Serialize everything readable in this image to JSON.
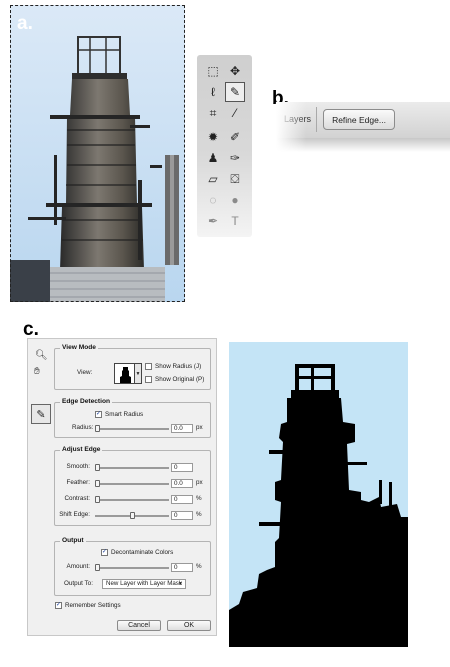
{
  "panel_labels": {
    "a": "a.",
    "b": "b.",
    "c": "c."
  },
  "toolbox": {
    "tools": [
      {
        "icon": "marquee-icon",
        "glyph": "⬚"
      },
      {
        "icon": "move-icon",
        "glyph": "✥"
      },
      {
        "icon": "lasso-icon",
        "glyph": "ℓ"
      },
      {
        "icon": "quick-selection-icon",
        "glyph": "✎"
      },
      {
        "icon": "crop-icon",
        "glyph": "⌗"
      },
      {
        "icon": "eyedropper-icon",
        "glyph": "⁄"
      },
      {
        "icon": "healing-brush-icon",
        "glyph": "✹"
      },
      {
        "icon": "brush-icon",
        "glyph": "✐"
      },
      {
        "icon": "clone-stamp-icon",
        "glyph": "♟"
      },
      {
        "icon": "history-brush-icon",
        "glyph": "✑"
      },
      {
        "icon": "eraser-icon",
        "glyph": "▱"
      },
      {
        "icon": "paint-bucket-icon",
        "glyph": "⛋"
      },
      {
        "icon": "blur-icon",
        "glyph": "◌"
      },
      {
        "icon": "dodge-icon",
        "glyph": "●"
      },
      {
        "icon": "pen-icon",
        "glyph": "✒"
      },
      {
        "icon": "type-icon",
        "glyph": "T"
      }
    ]
  },
  "options_bar": {
    "layers_label": "Layers",
    "refine_edge_button": "Refine Edge..."
  },
  "refine_edge_dialog": {
    "view_mode": {
      "title": "View Mode",
      "view_label": "View:",
      "show_radius": {
        "label": "Show Radius (J)",
        "checked": false
      },
      "show_original": {
        "label": "Show Original (P)",
        "checked": false
      }
    },
    "edge_detection": {
      "title": "Edge Detection",
      "smart_radius": {
        "label": "Smart Radius",
        "checked": true
      },
      "radius": {
        "label": "Radius:",
        "value": "0.0",
        "unit": "px",
        "level": 0.0
      }
    },
    "adjust_edge": {
      "title": "Adjust Edge",
      "smooth": {
        "label": "Smooth:",
        "value": "0",
        "unit": "",
        "level": 0.0
      },
      "feather": {
        "label": "Feather:",
        "value": "0.0",
        "unit": "px",
        "level": 0.0
      },
      "contrast": {
        "label": "Contrast:",
        "value": "0",
        "unit": "%",
        "level": 0.0
      },
      "shift_edge": {
        "label": "Shift Edge:",
        "value": "0",
        "unit": "%",
        "level": 0.5
      }
    },
    "output": {
      "title": "Output",
      "decontaminate": {
        "label": "Decontaminate Colors",
        "checked": true
      },
      "amount": {
        "label": "Amount:",
        "value": "0",
        "unit": "%",
        "level": 0.0
      },
      "output_to_label": "Output To:",
      "output_to_value": "New Layer with Layer Mask"
    },
    "remember_settings": {
      "label": "Remember Settings",
      "checked": true
    },
    "cancel_button": "Cancel",
    "ok_button": "OK"
  },
  "colors": {
    "sky": "#d8e8f6",
    "mask_bg": "#c4e4f6",
    "silhouette": "#000000",
    "dialog_bg": "#f0f0f0",
    "check_blue": "#1a3f9b"
  }
}
